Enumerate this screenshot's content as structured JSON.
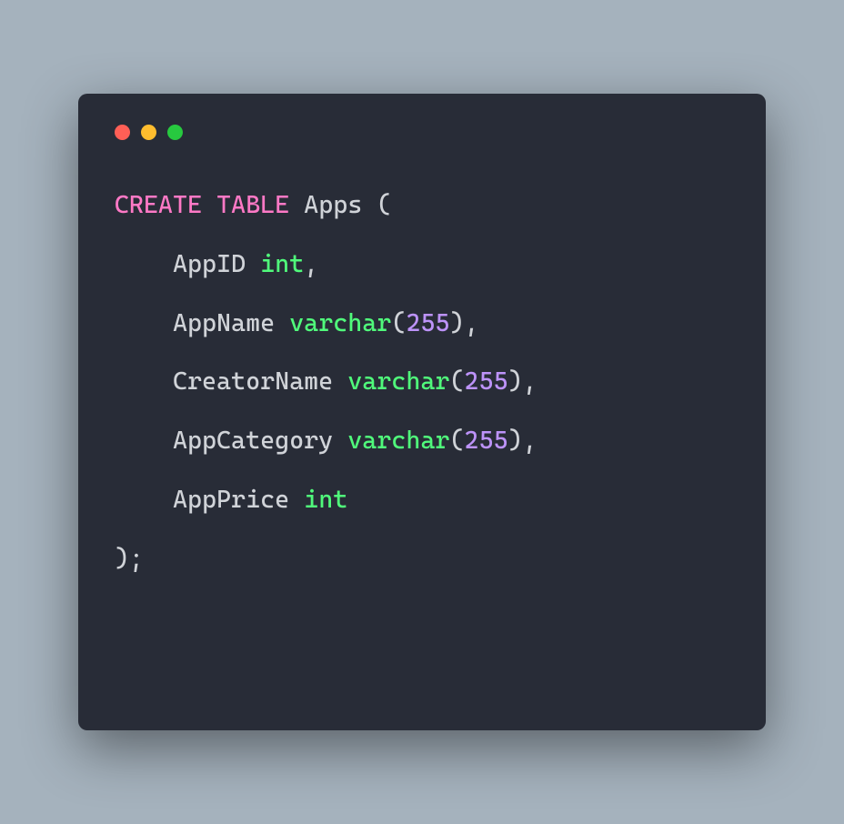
{
  "window": {
    "dots": [
      "red",
      "yellow",
      "green"
    ]
  },
  "code": {
    "keyword_create": "CREATE",
    "keyword_table": "TABLE",
    "table_name": "Apps",
    "paren_open": "(",
    "indent": "    ",
    "col1_name": "AppID",
    "col1_type": "int",
    "comma": ",",
    "col2_name": "AppName",
    "col2_type": "varchar",
    "col2_paren_open": "(",
    "col2_size": "255",
    "col2_paren_close": ")",
    "col3_name": "CreatorName",
    "col3_type": "varchar",
    "col3_paren_open": "(",
    "col3_size": "255",
    "col3_paren_close": ")",
    "col4_name": "AppCategory",
    "col4_type": "varchar",
    "col4_paren_open": "(",
    "col4_size": "255",
    "col4_paren_close": ")",
    "col5_name": "AppPrice",
    "col5_type": "int",
    "close": ");"
  }
}
